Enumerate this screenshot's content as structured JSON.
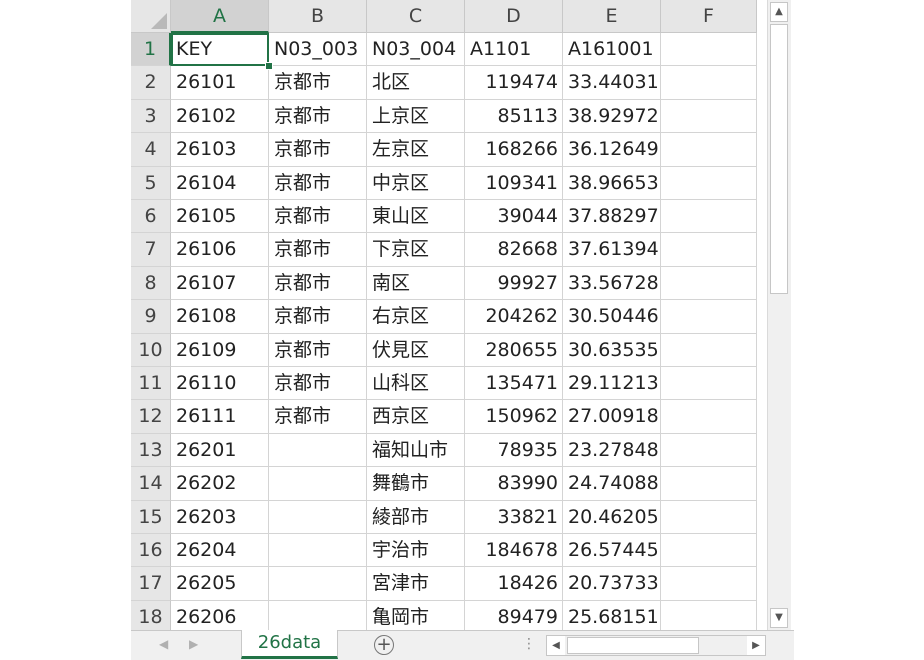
{
  "columns": [
    "A",
    "B",
    "C",
    "D",
    "E",
    "F"
  ],
  "active_column": "A",
  "active_row": "1",
  "row_numbers": [
    "1",
    "2",
    "3",
    "4",
    "5",
    "6",
    "7",
    "8",
    "9",
    "10",
    "11",
    "12",
    "13",
    "14",
    "15",
    "16",
    "17",
    "18"
  ],
  "rows": [
    [
      "KEY",
      "N03_003",
      "N03_004",
      "A1101",
      "A161001"
    ],
    [
      "26101",
      "京都市",
      "北区",
      "119474",
      "33.44031"
    ],
    [
      "26102",
      "京都市",
      "上京区",
      "85113",
      "38.92972"
    ],
    [
      "26103",
      "京都市",
      "左京区",
      "168266",
      "36.12649"
    ],
    [
      "26104",
      "京都市",
      "中京区",
      "109341",
      "38.96653"
    ],
    [
      "26105",
      "京都市",
      "東山区",
      "39044",
      "37.88297"
    ],
    [
      "26106",
      "京都市",
      "下京区",
      "82668",
      "37.61394"
    ],
    [
      "26107",
      "京都市",
      "南区",
      "99927",
      "33.56728"
    ],
    [
      "26108",
      "京都市",
      "右京区",
      "204262",
      "30.50446"
    ],
    [
      "26109",
      "京都市",
      "伏見区",
      "280655",
      "30.63535"
    ],
    [
      "26110",
      "京都市",
      "山科区",
      "135471",
      "29.11213"
    ],
    [
      "26111",
      "京都市",
      "西京区",
      "150962",
      "27.00918"
    ],
    [
      "26201",
      "",
      "福知山市",
      "78935",
      "23.27848"
    ],
    [
      "26202",
      "",
      "舞鶴市",
      "83990",
      "24.74088"
    ],
    [
      "26203",
      "",
      "綾部市",
      "33821",
      "20.46205"
    ],
    [
      "26204",
      "",
      "宇治市",
      "184678",
      "26.57445"
    ],
    [
      "26205",
      "",
      "宮津市",
      "18426",
      "20.73733"
    ],
    [
      "26206",
      "",
      "亀岡市",
      "89479",
      "25.68151"
    ]
  ],
  "sheet_tab": "26data",
  "add_sheet_glyph": "+",
  "split_glyph": "⋮",
  "icons": {
    "scroll_up": "up-arrow-icon",
    "scroll_down": "down-arrow-icon",
    "scroll_left": "left-arrow-icon",
    "scroll_right": "right-arrow-icon",
    "tab_prev": "tab-prev-icon",
    "tab_next": "tab-next-icon",
    "add_sheet": "plus-circle-icon",
    "select_all": "select-all-triangle-icon"
  },
  "colors": {
    "accent": "#217346",
    "header_bg": "#e6e6e6",
    "grid_line": "#d4d4d4"
  }
}
